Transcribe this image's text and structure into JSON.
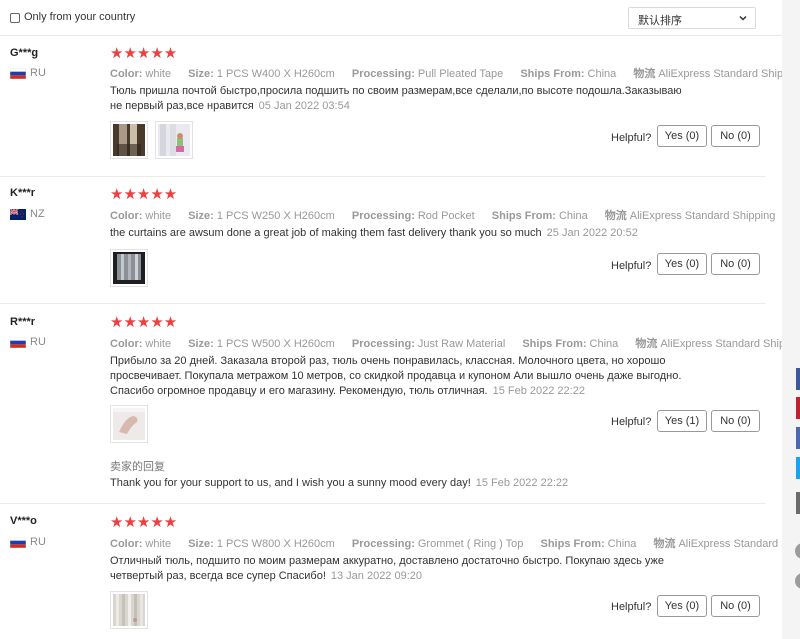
{
  "filter": {
    "country_label": "Only from your country",
    "sort_value": "默认排序"
  },
  "labels": {
    "color": "Color:",
    "size": "Size:",
    "processing": "Processing:",
    "ships_from": "Ships From:",
    "logistics": "物流",
    "helpful": "Helpful?"
  },
  "reviews": [
    {
      "user": "G***g",
      "country": "RU",
      "stars": "★★★★★",
      "color": "white",
      "size": "1 PCS W400 X H260cm",
      "processing": "Pull Pleated Tape",
      "ships_from": "China",
      "logistics": "AliExpress Standard Shipping",
      "text_lines": [
        "Тюль пришла почтой быстро,просила подшить по своим размерам,все сделали,по высоте подошла.Заказываю",
        "не первый раз,все нравится"
      ],
      "date": "05 Jan 2022 03:54",
      "yes": "Yes (0)",
      "no": "No (0)"
    },
    {
      "user": "K***r",
      "country": "NZ",
      "stars": "★★★★★",
      "color": "white",
      "size": "1 PCS W250 X H260cm",
      "processing": "Rod Pocket",
      "ships_from": "China",
      "logistics": "AliExpress Standard Shipping",
      "text_lines": [
        "the curtains are awsum done a great job of making them fast delivery thank you so much"
      ],
      "date": "25 Jan 2022 20:52",
      "yes": "Yes (0)",
      "no": "No (0)"
    },
    {
      "user": "R***r",
      "country": "RU",
      "stars": "★★★★★",
      "color": "white",
      "size": "1 PCS W500 X H260cm",
      "processing": "Just Raw Material",
      "ships_from": "China",
      "logistics": "AliExpress Standard Shipping",
      "text_lines": [
        "Прибыло за 20 дней. Заказала второй раз, тюль очень понравилась, классная. Молочного цвета, но хорошо",
        "просвечивает. Покупала метражом 10 метров, со скидкой продавца и купоном Али вышло очень даже выгодно.",
        "Спасибо огромное продавцу и его магазину. Рекомендую, тюль отличная."
      ],
      "date": "15 Feb 2022 22:22",
      "yes": "Yes (1)",
      "no": "No (0)",
      "seller_label": "卖家的回复",
      "seller_reply": "Thank you for your support to us, and I wish you a sunny mood every day!",
      "seller_date": "15 Feb 2022 22:22"
    },
    {
      "user": "V***o",
      "country": "RU",
      "stars": "★★★★★",
      "color": "white",
      "size": "1 PCS W800 X H260cm",
      "processing": "Grommet ( Ring ) Top",
      "ships_from": "China",
      "logistics": "AliExpress Standard Shipping",
      "text_lines": [
        "Отличный тюль, подшито по моим размерам аккуратно, доставлено достаточно быстро. Покупаю здесь уже",
        "четвертый раз, всегда все супер Спасибо!"
      ],
      "date": "13 Jan 2022 09:20",
      "yes": "Yes (0)",
      "no": "No (0)"
    }
  ],
  "colors": {
    "star": "#ea4141",
    "side_tabs": [
      "#3b5998",
      "#c0202f",
      "#4a69b0",
      "#1da1f2",
      "#6b6b6b"
    ]
  }
}
